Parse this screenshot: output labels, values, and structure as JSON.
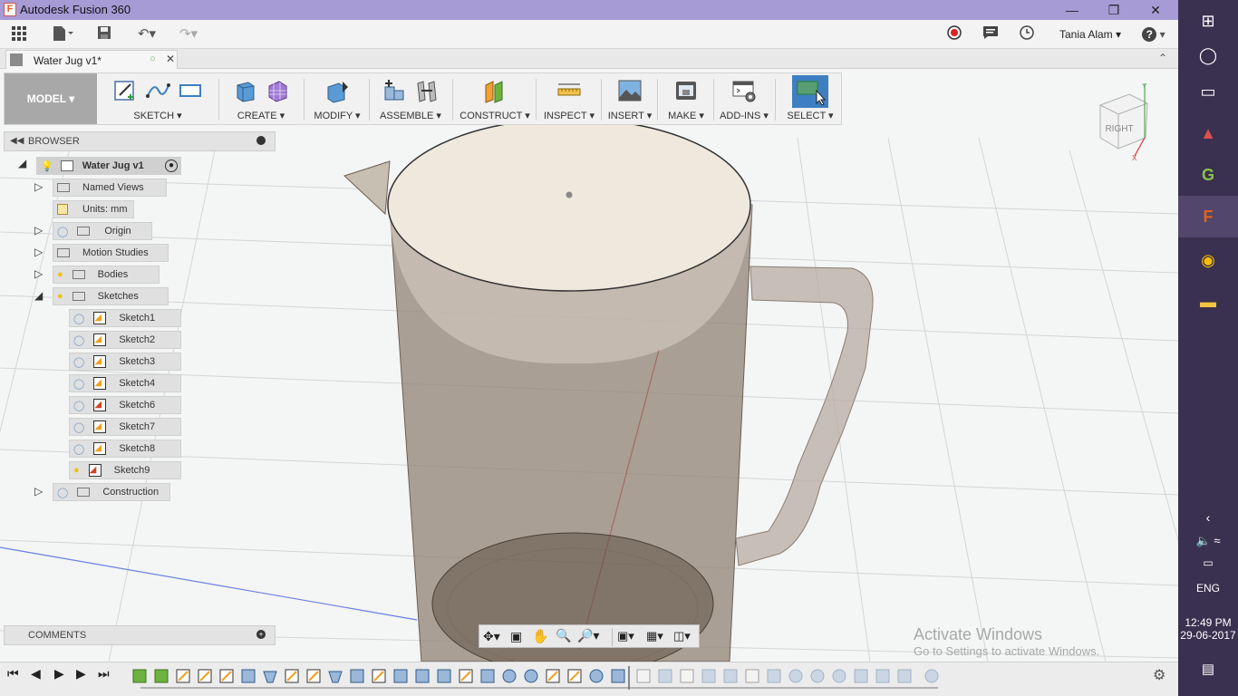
{
  "window": {
    "title": "Autodesk Fusion 360",
    "app_icon": "F"
  },
  "qat": {
    "user": "Tania Alam",
    "help": "?"
  },
  "document": {
    "tab_title": "Water Jug v1*"
  },
  "ribbon": {
    "workspace": "MODEL",
    "groups": [
      {
        "label": "SKETCH ▾"
      },
      {
        "label": "CREATE ▾"
      },
      {
        "label": "MODIFY ▾"
      },
      {
        "label": "ASSEMBLE ▾"
      },
      {
        "label": "CONSTRUCT ▾"
      },
      {
        "label": "INSPECT ▾"
      },
      {
        "label": "INSERT ▾"
      },
      {
        "label": "MAKE ▾"
      },
      {
        "label": "ADD-INS ▾"
      },
      {
        "label": "SELECT ▾"
      }
    ]
  },
  "browser": {
    "header": "BROWSER",
    "root": "Water Jug v1",
    "items": [
      {
        "label": "Named Views"
      },
      {
        "label": "Units: mm"
      },
      {
        "label": "Origin"
      },
      {
        "label": "Motion Studies"
      },
      {
        "label": "Bodies"
      },
      {
        "label": "Sketches"
      },
      {
        "label": "Sketch1"
      },
      {
        "label": "Sketch2"
      },
      {
        "label": "Sketch3"
      },
      {
        "label": "Sketch4"
      },
      {
        "label": "Sketch6"
      },
      {
        "label": "Sketch7"
      },
      {
        "label": "Sketch8"
      },
      {
        "label": "Sketch9"
      },
      {
        "label": "Construction"
      }
    ]
  },
  "comments": {
    "header": "COMMENTS"
  },
  "viewcube": {
    "face": "RIGHT"
  },
  "watermark": {
    "line1": "Activate Windows",
    "line2": "Go to Settings to activate Windows."
  },
  "taskbar": {
    "lang": "ENG",
    "time": "12:49 PM",
    "date": "29-06-2017"
  },
  "colors": {
    "accent": "#3d7fc1",
    "titlebar": "#a79bd6",
    "taskbar": "#3a3150",
    "jug": "#8a7a6c",
    "lid": "#efe8dc"
  }
}
